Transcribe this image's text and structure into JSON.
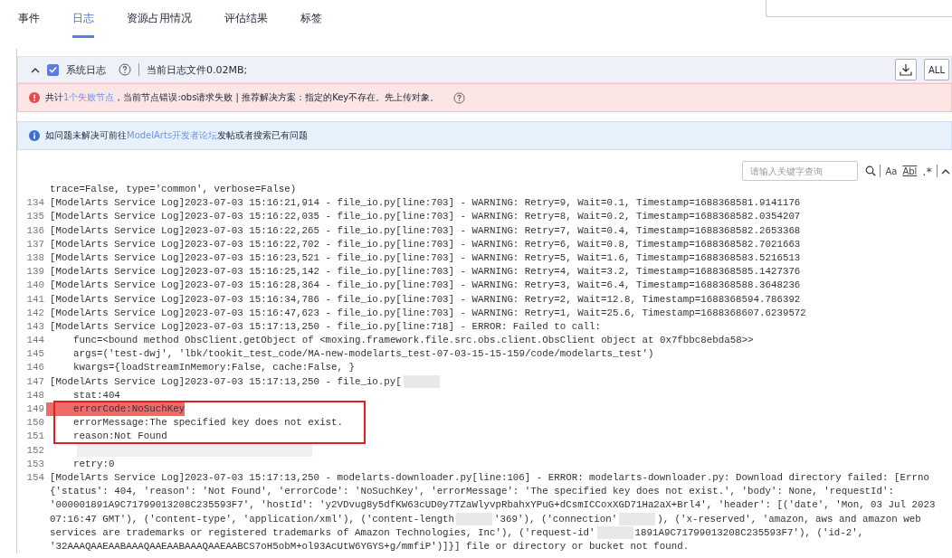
{
  "tabs": [
    {
      "label": "事件",
      "selected": false
    },
    {
      "label": "日志",
      "selected": true
    },
    {
      "label": "资源占用情况",
      "selected": false
    },
    {
      "label": "评估结果",
      "selected": false
    },
    {
      "label": "标签",
      "selected": false
    }
  ],
  "toolbar": {
    "expanded": true,
    "checkbox": {
      "label": "系统日志",
      "checked": true
    },
    "file_info": "当前日志文件0.02MB;",
    "all_button": "ALL"
  },
  "alerts": [
    {
      "kind": "error",
      "prefix": "共计",
      "link": "1个失败节点",
      "suffix": "，当前节点错误:obs请求失败 | 推荐解决方案：指定的Key不存在。先上传对象。",
      "help": true
    },
    {
      "kind": "info",
      "prefix": "如问题未解决可前往",
      "link": "ModelArts开发者论坛",
      "suffix": "发帖或者搜索已有问题",
      "help": false
    }
  ],
  "search": {
    "placeholder": "请输入关键字查询",
    "case_label": "Aa",
    "word_label": "Abl",
    "regex_label": ".*"
  },
  "log": {
    "lines": [
      {
        "kind": "entry",
        "parts": [
          "trace=False, type='common', verbose=False)"
        ]
      },
      {
        "number": "134",
        "kind": "entry",
        "parts": [
          "[ModelArts Service Log]2023-07-03 15:16:21,914 - file_io.py[line:703] - WARNING: Retry=9, Wait=0.1, Timestamp=1688368581.9141176"
        ]
      },
      {
        "number": "135",
        "kind": "entry",
        "parts": [
          "[ModelArts Service Log]2023-07-03 15:16:22,035 - file_io.py[line:703] - WARNING: Retry=8, Wait=0.2, Timestamp=1688368582.0354207"
        ]
      },
      {
        "number": "136",
        "kind": "entry",
        "parts": [
          "[ModelArts Service Log]2023-07-03 15:16:22,265 - file_io.py[line:703] - WARNING: Retry=7, Wait=0.4, Timestamp=1688368582.2653368"
        ]
      },
      {
        "number": "137",
        "kind": "entry",
        "parts": [
          "[ModelArts Service Log]2023-07-03 15:16:22,702 - file_io.py[line:703] - WARNING: Retry=6, Wait=0.8, Timestamp=1688368582.7021663"
        ]
      },
      {
        "number": "138",
        "kind": "entry",
        "parts": [
          "[ModelArts Service Log]2023-07-03 15:16:23,521 - file_io.py[line:703] - WARNING: Retry=5, Wait=1.6, Timestamp=1688368583.5216513"
        ]
      },
      {
        "number": "139",
        "kind": "entry",
        "parts": [
          "[ModelArts Service Log]2023-07-03 15:16:25,142 - file_io.py[line:703] - WARNING: Retry=4, Wait=3.2, Timestamp=1688368585.1427376"
        ]
      },
      {
        "number": "140",
        "kind": "entry",
        "parts": [
          "[ModelArts Service Log]2023-07-03 15:16:28,364 - file_io.py[line:703] - WARNING: Retry=3, Wait=6.4, Timestamp=1688368588.3648236"
        ]
      },
      {
        "number": "141",
        "kind": "entry",
        "parts": [
          "[ModelArts Service Log]2023-07-03 15:16:34,786 - file_io.py[line:703] - WARNING: Retry=2, Wait=12.8, Timestamp=1688368594.786392"
        ]
      },
      {
        "number": "142",
        "kind": "entry",
        "parts": [
          "[ModelArts Service Log]2023-07-03 15:16:47,623 - file_io.py[line:703] - WARNING: Retry=1, Wait=25.6, Timestamp=1688368607.6239572"
        ]
      },
      {
        "number": "143",
        "kind": "entry",
        "parts": [
          "[ModelArts Service Log]2023-07-03 15:17:13,250 - file_io.py[line:718] - ERROR: Failed to call:"
        ]
      },
      {
        "number": "144",
        "kind": "detail",
        "parts": [
          "func=<bound method ObsClient.getObject of <moxing.framework.file.src.obs.client.ObsClient object at 0x7fbbc8ebda58>>"
        ]
      },
      {
        "number": "145",
        "kind": "detail",
        "parts": [
          "args=('test-dwj', 'lbk/tookit_test_code/MA-new-modelarts_test-07-03-15-15-159/code/modelarts_test')"
        ]
      },
      {
        "number": "146",
        "kind": "detail",
        "parts": [
          "kwargs={loadStreamInMemory:False, cache:False, }"
        ]
      },
      {
        "number": "147",
        "kind": "entry",
        "parts": [
          "[ModelArts Service Log]2023-07-03 15:17:13,250 - file_io.py["
        ],
        "redacted_end": true
      },
      {
        "number": "148",
        "kind": "detail",
        "parts": [
          "stat:404"
        ]
      },
      {
        "number": "149",
        "kind": "detail",
        "parts": [
          "errorCode:NoSuchKey"
        ],
        "highlighted": true,
        "boxed": true
      },
      {
        "number": "150",
        "kind": "detail",
        "parts": [
          "errorMessage:The specified key does not exist."
        ],
        "highlighted": false,
        "boxed": true
      },
      {
        "number": "151",
        "kind": "detail",
        "parts": [
          "reason:Not Found"
        ],
        "highlighted": false,
        "boxed": true
      },
      {
        "number": "152",
        "kind": "redacted"
      },
      {
        "number": "153",
        "kind": "detail",
        "parts": [
          "retry:0"
        ]
      },
      {
        "number": "154",
        "kind": "entry",
        "parts": [
          "[ModelArts Service Log]2023-07-03 15:17:13,250 - modelarts-downloader.py[line:106] - ERROR: modelarts-downloader.py: Download directory failed: [Errno"
        ]
      },
      {
        "kind": "entry",
        "parts": [
          "{'status': 404, 'reason': 'Not Found', 'errorCode': 'NoSuchKey', 'errorMessage': 'The specified key does not exist.', 'body': None, 'requestId':"
        ]
      },
      {
        "kind": "entry",
        "parts": [
          "'000001891A9C71799013208C235593F7', 'hostId': 'y2VDvug8y5dfKW63cUD0y7TZaWlyvpRbahxYPuG+dCsmICCoxXGD71Ha2aX+Brl4', 'header': [('date', 'Mon, 03 Jul 2023"
        ]
      },
      {
        "kind": "entry",
        "parts": [
          "07:16:47 GMT'), ('content-type', 'application/xml'), ('content-length",
          "'369'), ('connection'",
          "), ('x-reserved', 'amazon, aws and amazon web"
        ]
      },
      {
        "kind": "entry",
        "parts": [
          "services are trademarks or registered trademarks of Amazon Technologies, Inc'), ('request-id'",
          "1891A9C71799013208C235593F7'), ('id-2',"
        ]
      },
      {
        "kind": "entry",
        "parts": [
          "'32AAAQAAEAABAAAQAAEAABAAAQAAEAABCS7oH5obM+ol93AcUtW6YGYS+g/mmfiP')]}] file or directory or bucket not found."
        ]
      }
    ]
  }
}
